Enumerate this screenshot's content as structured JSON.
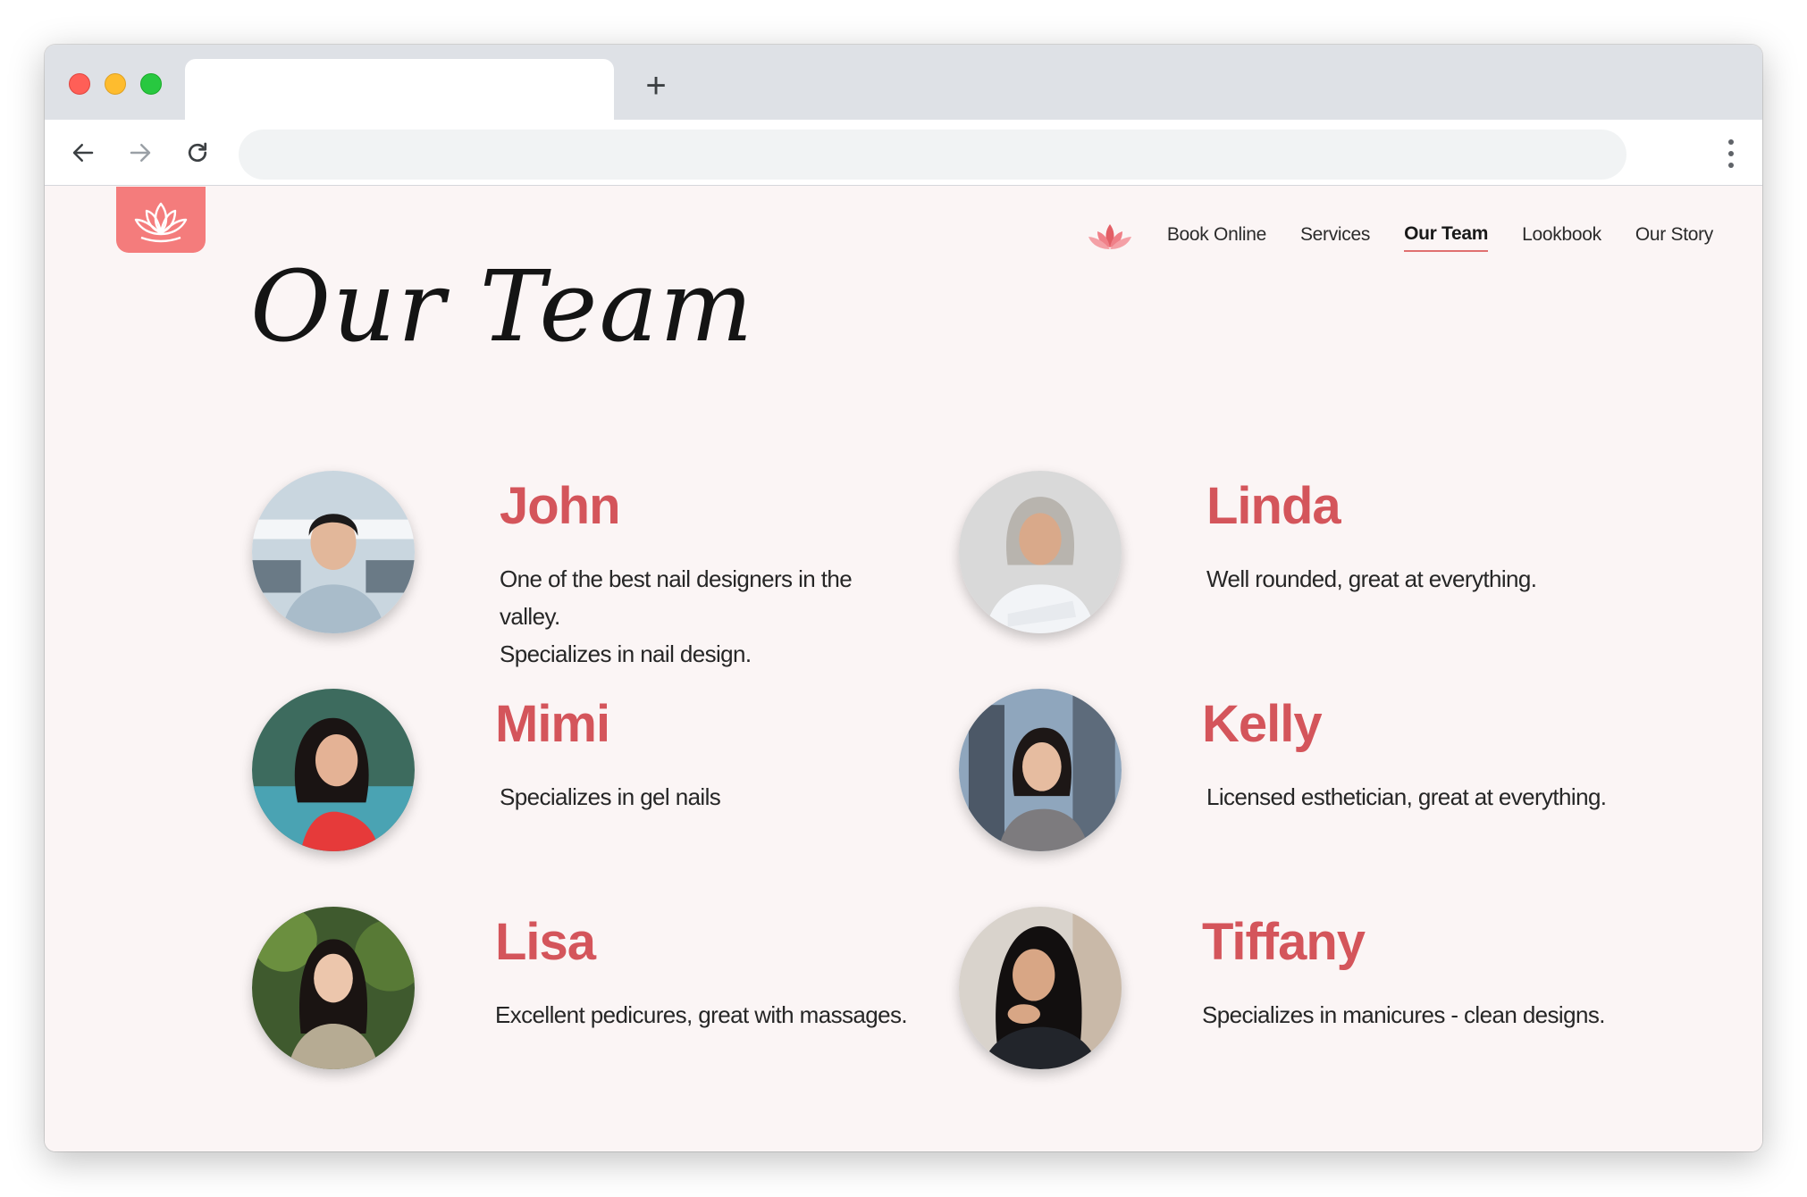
{
  "browser": {
    "new_tab_label": "+",
    "address_value": ""
  },
  "nav": {
    "items": [
      {
        "label": "Book Online"
      },
      {
        "label": "Services"
      },
      {
        "label": "Our Team",
        "active": true
      },
      {
        "label": "Lookbook"
      },
      {
        "label": "Our Story"
      }
    ]
  },
  "page": {
    "title": "Our Team"
  },
  "team": [
    {
      "name": "John",
      "description": [
        "One of the best nail designers in the valley.",
        "Specializes in nail design."
      ]
    },
    {
      "name": "Linda",
      "description": [
        "Well rounded, great at everything."
      ]
    },
    {
      "name": "Mimi",
      "description": [
        "Specializes in gel nails"
      ]
    },
    {
      "name": "Kelly",
      "description": [
        "Licensed esthetician, great at everything."
      ]
    },
    {
      "name": "Lisa",
      "description": [
        "Excellent pedicures, great with massages."
      ]
    },
    {
      "name": "Tiffany",
      "description": [
        "Specializes in manicures - clean designs."
      ]
    }
  ],
  "colors": {
    "accent": "#d4555b",
    "logo_bg": "#f47c7c",
    "page_bg": "#fbf5f5"
  },
  "icons": {
    "logo": "lotus-icon",
    "nav_logo": "lotus-icon",
    "back": "arrow-left-icon",
    "forward": "arrow-right-icon",
    "reload": "reload-icon",
    "menu": "kebab-menu-icon"
  }
}
